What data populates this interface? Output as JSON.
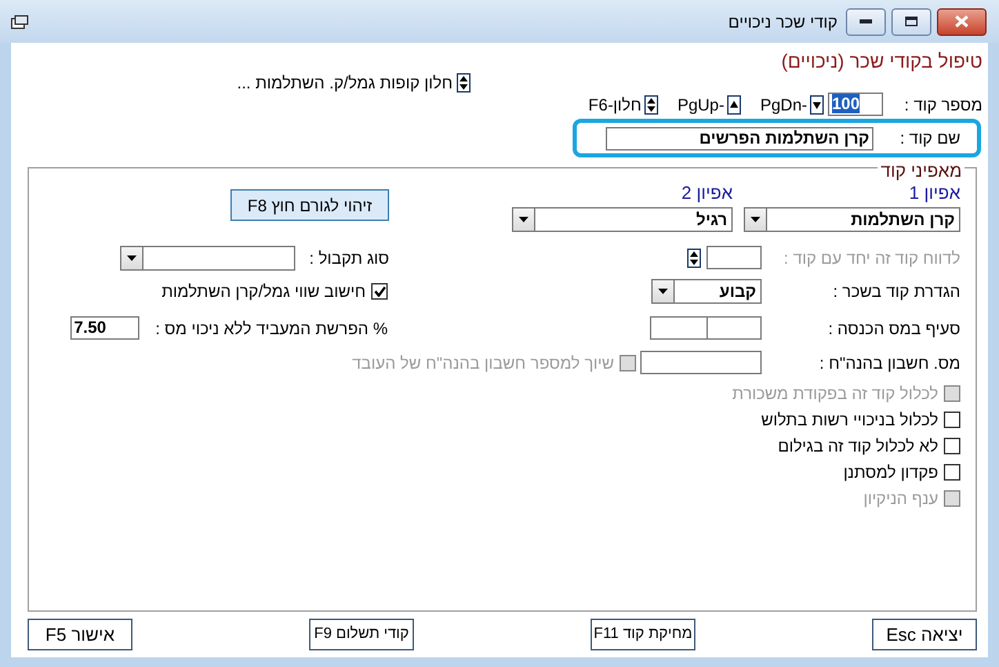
{
  "window": {
    "title": "קודי שכר ניכויים"
  },
  "heading": "טיפול בקודי שכר (ניכויים)",
  "fund_window": {
    "label": "חלון קופות גמל/ק. השתלמות ..."
  },
  "code_number": {
    "label": "מספר קוד :",
    "value": "100"
  },
  "navigation": [
    {
      "kind": "down",
      "label": "-PgDn"
    },
    {
      "kind": "up",
      "label": "-PgUp"
    },
    {
      "kind": "spin",
      "label": "חלון-F6"
    }
  ],
  "code_name": {
    "label": "שם קוד :",
    "value": "קרן השתלמות הפרשים"
  },
  "group": {
    "title": "מאפיני קוד",
    "type_1": {
      "label": "אפיון 1",
      "value": "קרן השתלמות"
    },
    "type_2": {
      "label": "אפיון 2",
      "value": "רגיל"
    },
    "external_button": "זיהוי לגורם חוץ F8",
    "report_with_code": {
      "label": "לדווח קוד זה יחד עם קוד :",
      "disabled": true
    },
    "receipt_type": {
      "label": "סוג תקבול :"
    },
    "code_definition": {
      "label": "הגדרת קוד בשכר :",
      "value": "קבוע"
    },
    "compute_value": {
      "label": "חישוב שווי גמל/קרן השתלמות",
      "checked": true,
      "disabled": false
    },
    "tax_section": {
      "label": "סעיף במס הכנסה :"
    },
    "employer_share": {
      "label": "% הפרשת המעביד ללא ניכוי מס :",
      "value": "7.50"
    },
    "account_number": {
      "label": "מס. חשבון בהנה\"ח :"
    },
    "link_account": {
      "label": "שיוך למספר חשבון בהנה\"ח של העובד",
      "checked": false,
      "disabled": true
    },
    "options": [
      {
        "label": "לכלול קוד זה בפקודת משכורת",
        "checked": false,
        "disabled": true
      },
      {
        "label": "לכלול בניכויי רשות בתלוש",
        "checked": false,
        "disabled": false
      },
      {
        "label": "לא לכלול קוד זה בגילום",
        "checked": false,
        "disabled": false
      },
      {
        "label": "פקדון למסתנן",
        "checked": false,
        "disabled": false
      },
      {
        "label": "ענף הניקיון",
        "checked": false,
        "disabled": true
      }
    ]
  },
  "buttons": [
    {
      "label": "יציאה Esc"
    },
    {
      "label": "מחיקת קוד F11"
    },
    {
      "label": "קודי תשלום F9"
    },
    {
      "label": "אישור F5"
    }
  ]
}
